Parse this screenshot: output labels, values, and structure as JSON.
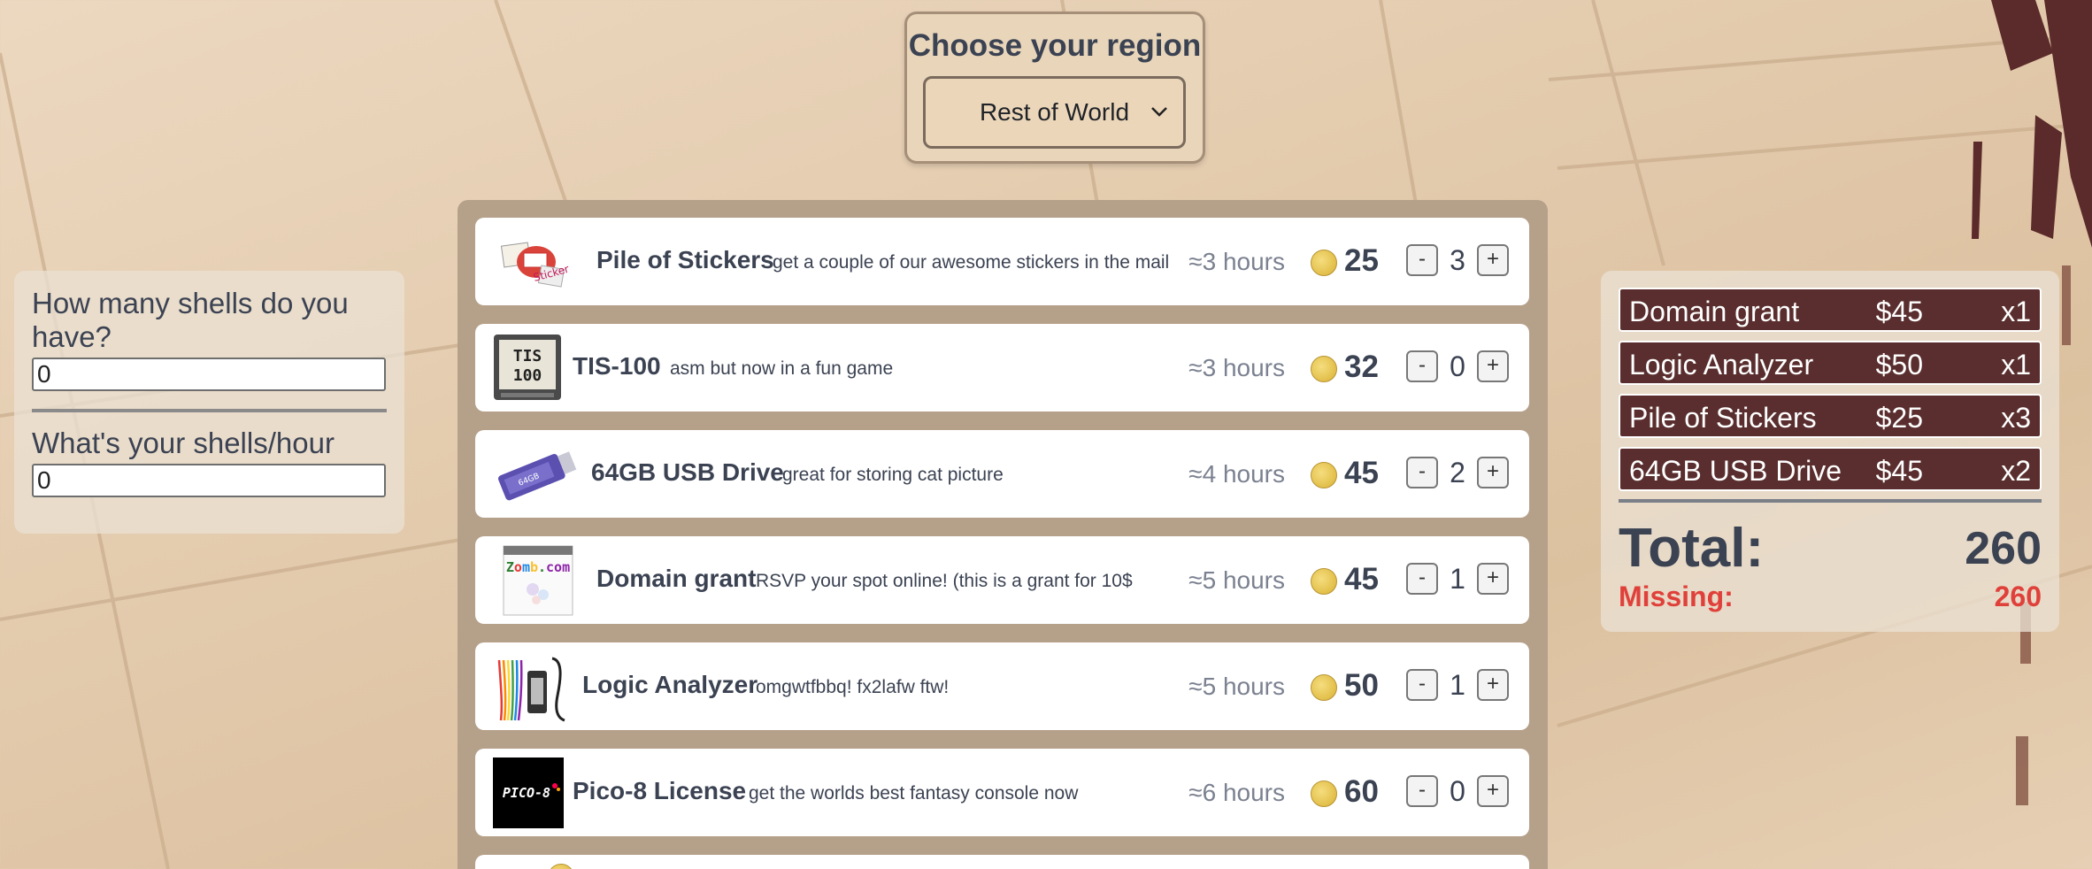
{
  "region": {
    "title": "Choose your region",
    "selected": "Rest of World"
  },
  "calculator": {
    "shells_label": "How many shells do you have?",
    "shells_value": "0",
    "rate_label": "What's your shells/hour",
    "rate_value": "0"
  },
  "items": [
    {
      "name": "Pile of Stickers",
      "desc": "get a couple of our awesome stickers in the mail",
      "hours": "≈3 hours",
      "price": "25",
      "qty": "3",
      "icon": "stickers-image"
    },
    {
      "name": "TIS-100",
      "desc": "asm but now in a fun game",
      "hours": "≈3 hours",
      "price": "32",
      "qty": "0",
      "icon": "tis-100-image"
    },
    {
      "name": "64GB USB Drive",
      "desc": "great for storing cat picture",
      "hours": "≈4 hours",
      "price": "45",
      "qty": "2",
      "icon": "usb-drive-image"
    },
    {
      "name": "Domain grant",
      "desc": "RSVP your spot online! (this is a grant for 10$",
      "hours": "≈5 hours",
      "price": "45",
      "qty": "1",
      "icon": "domain-image"
    },
    {
      "name": "Logic Analyzer",
      "desc": "omgwtfbbq! fx2lafw ftw!",
      "hours": "≈5 hours",
      "price": "50",
      "qty": "1",
      "icon": "logic-analyzer-image"
    },
    {
      "name": "Pico-8 License",
      "desc": "get the worlds best fantasy console now",
      "hours": "≈6 hours",
      "price": "60",
      "qty": "0",
      "icon": "pico-8-image"
    }
  ],
  "controls": {
    "minus": "-",
    "plus": "+"
  },
  "cart": {
    "rows": [
      {
        "name": "Domain grant",
        "price": "$45",
        "count": "x1"
      },
      {
        "name": "Logic Analyzer",
        "price": "$50",
        "count": "x1"
      },
      {
        "name": "Pile of Stickers",
        "price": "$25",
        "count": "x3"
      },
      {
        "name": "64GB USB Drive",
        "price": "$45",
        "count": "x2"
      }
    ],
    "total_label": "Total:",
    "total_value": "260",
    "missing_label": "Missing:",
    "missing_value": "260"
  },
  "colors": {
    "cart_row": "#5a2e2e",
    "missing": "#e0403a",
    "coin": "#e2bf4a",
    "frame": "#b5a08a"
  }
}
